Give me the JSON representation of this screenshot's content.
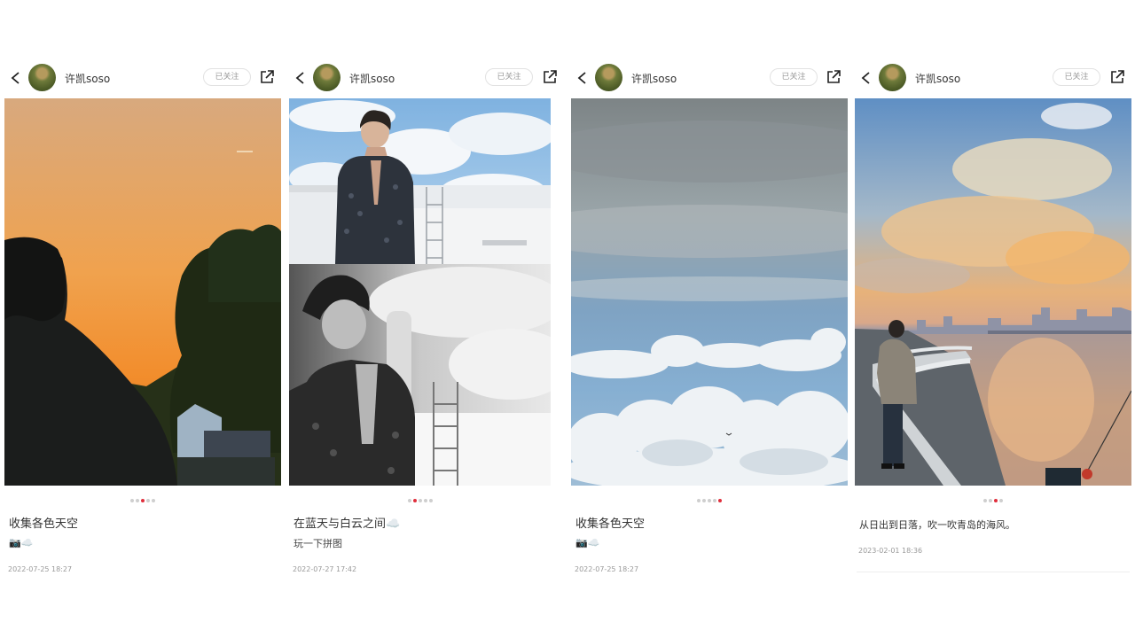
{
  "posts": [
    {
      "username": "许凯soso",
      "follow_label": "已关注",
      "title": "收集各色天空",
      "subtitle": "📷☁️",
      "date": "2022-07-25 18:27",
      "image_count": 5,
      "active_image": 3
    },
    {
      "username": "许凯soso",
      "follow_label": "已关注",
      "title": "在蓝天与白云之间☁️",
      "subtitle": "玩一下拼图",
      "date": "2022-07-27 17:42",
      "image_count": 5,
      "active_image": 2
    },
    {
      "username": "许凯soso",
      "follow_label": "已关注",
      "title": "收集各色天空",
      "subtitle": "📷☁️",
      "date": "2022-07-25 18:27",
      "image_count": 5,
      "active_image": 5
    },
    {
      "username": "许凯soso",
      "follow_label": "已关注",
      "title": "从日出到日落，吹一吹青岛的海风。",
      "date": "2023-02-01 18:36",
      "image_count": 4,
      "active_image": 3
    }
  ],
  "icons": {
    "back": "chevron-left-icon",
    "share": "share-external-icon"
  },
  "colors": {
    "active_dot": "#e02e3c",
    "inactive_dot": "#cfcfcf"
  }
}
